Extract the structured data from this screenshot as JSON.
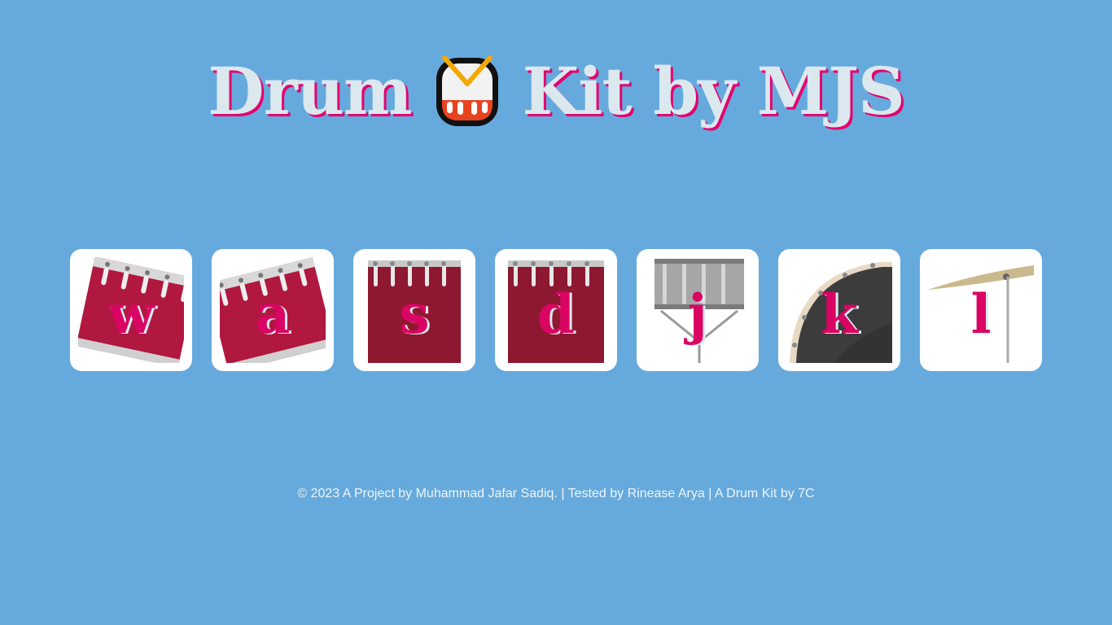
{
  "header": {
    "title_part1": "Drum",
    "title_part2": "Kit by MJS",
    "emoji_icon": "drum-emoji-icon"
  },
  "drums": [
    {
      "key": "w",
      "instrument": "tom-1"
    },
    {
      "key": "a",
      "instrument": "tom-2"
    },
    {
      "key": "s",
      "instrument": "tom-3"
    },
    {
      "key": "d",
      "instrument": "tom-4"
    },
    {
      "key": "j",
      "instrument": "snare"
    },
    {
      "key": "k",
      "instrument": "kick-bass"
    },
    {
      "key": "l",
      "instrument": "crash"
    }
  ],
  "footer": {
    "text": "© 2023 A Project by Muhammad Jafar Sadiq. | Tested by Rinease Arya | A Drum Kit by 7C"
  },
  "colors": {
    "background": "#66aadd",
    "title": "#dbe8ee",
    "accent": "#da0463"
  }
}
